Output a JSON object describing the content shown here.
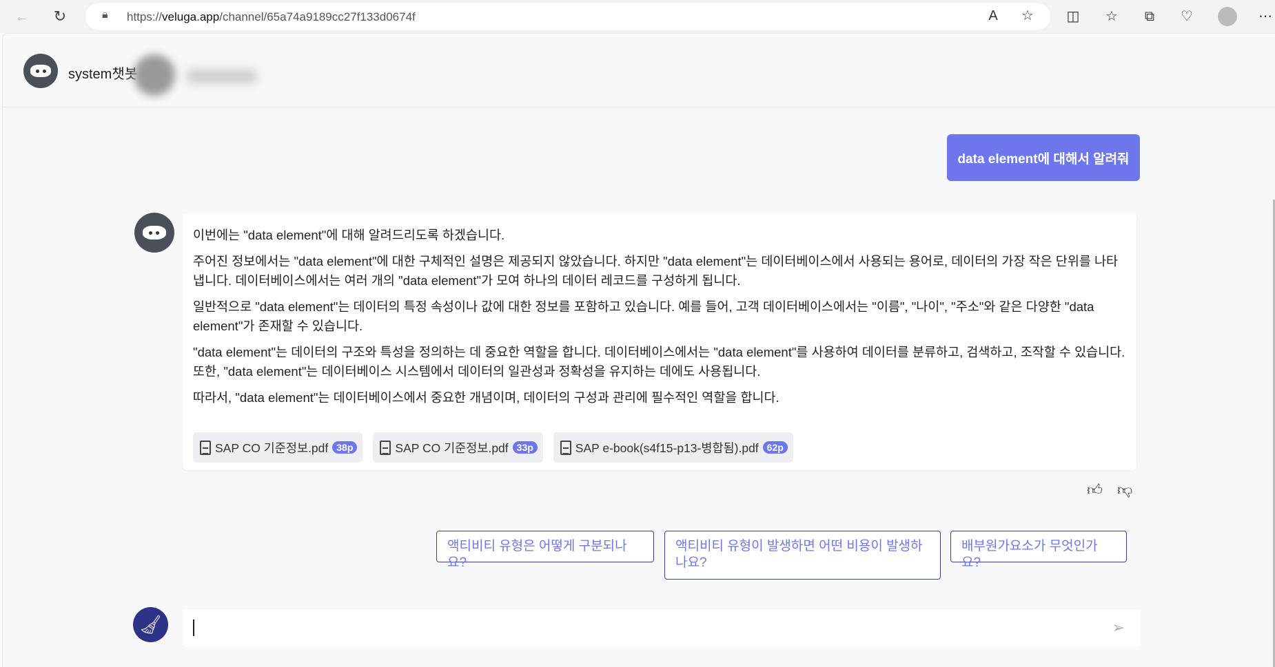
{
  "browser": {
    "url_prefix": "https://",
    "url_domain": "veluga.app",
    "url_path": "/channel/65a74a9189cc27f133d0674f"
  },
  "header": {
    "title": "system챗봇"
  },
  "user_message": "data element에 대해서 알려줘",
  "bot_message": {
    "paragraphs": [
      "이번에는 \"data element\"에 대해 알려드리도록 하겠습니다.",
      "주어진 정보에서는 \"data element\"에 대한 구체적인 설명은 제공되지 않았습니다. 하지만 \"data element\"는 데이터베이스에서 사용되는 용어로, 데이터의 가장 작은 단위를 나타냅니다. 데이터베이스에서는 여러 개의 \"data element\"가 모여 하나의 데이터 레코드를 구성하게 됩니다.",
      "일반적으로 \"data element\"는 데이터의 특정 속성이나 값에 대한 정보를 포함하고 있습니다. 예를 들어, 고객 데이터베이스에서는 \"이름\", \"나이\", \"주소\"와 같은 다양한 \"data element\"가 존재할 수 있습니다.",
      "\"data element\"는 데이터의 구조와 특성을 정의하는 데 중요한 역할을 합니다. 데이터베이스에서는 \"data element\"를 사용하여 데이터를 분류하고, 검색하고, 조작할 수 있습니다. 또한, \"data element\"는 데이터베이스 시스템에서 데이터의 일관성과 정확성을 유지하는 데에도 사용됩니다.",
      "따라서, \"data element\"는 데이터베이스에서 중요한 개념이며, 데이터의 구성과 관리에 필수적인 역할을 합니다."
    ],
    "sources": [
      {
        "name": "SAP CO 기준정보.pdf",
        "page": "38p"
      },
      {
        "name": "SAP CO 기준정보.pdf",
        "page": "33p"
      },
      {
        "name": "SAP e-book(s4f15-p13-병합됨).pdf",
        "page": "62p"
      }
    ]
  },
  "suggestions": [
    "액티비티 유형은 어떻게 구분되나요?",
    "액티비티 유형이 발생하면 어떤 비용이 발생하나요?",
    "배부원가요소가 무엇인가요?"
  ],
  "input": {
    "value": ""
  },
  "colors": {
    "accent": "#6e76ec",
    "dark_accent": "#2c3286"
  }
}
